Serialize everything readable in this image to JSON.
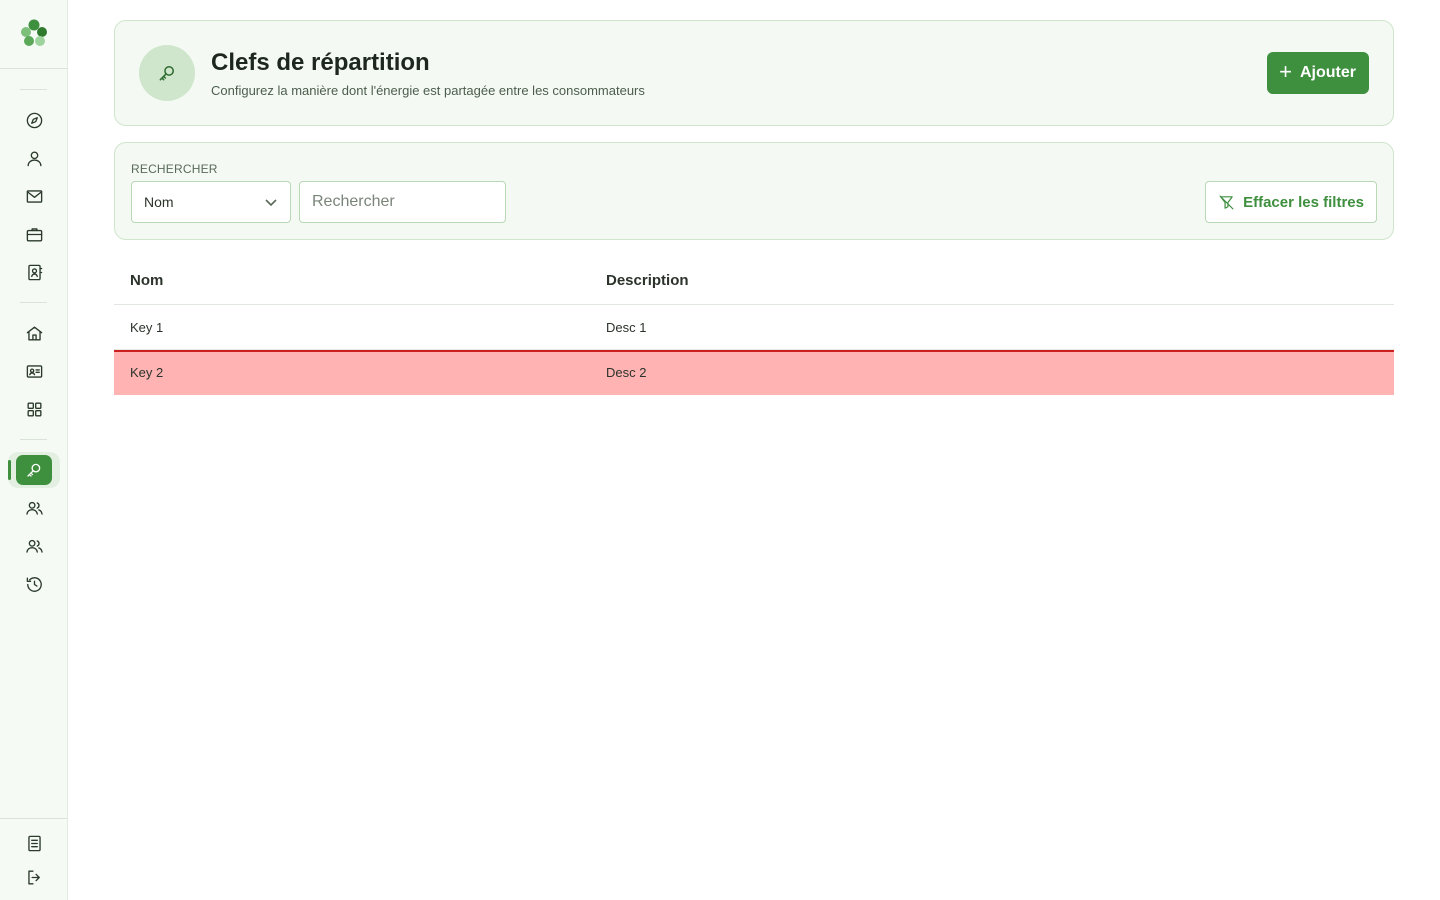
{
  "header": {
    "title": "Clefs de répartition",
    "subtitle": "Configurez la manière dont l'énergie est partagée entre les consommateurs",
    "add_label": "Ajouter"
  },
  "filters": {
    "label": "RECHERCHER",
    "field_selected": "Nom",
    "search_placeholder": "Rechercher",
    "search_value": "",
    "clear_label": "Effacer les filtres"
  },
  "table": {
    "columns": [
      "Nom",
      "Description"
    ],
    "rows": [
      {
        "name": "Key 1",
        "description": "Desc 1",
        "selected": false
      },
      {
        "name": "Key 2",
        "description": "Desc 2",
        "selected": true
      }
    ]
  },
  "sidebar": {
    "items": [
      {
        "icon": "compass-icon"
      },
      {
        "icon": "user-icon"
      },
      {
        "icon": "mail-icon"
      },
      {
        "icon": "briefcase-icon"
      },
      {
        "icon": "contact-book-icon"
      },
      {
        "icon": "home-icon"
      },
      {
        "icon": "id-card-icon"
      },
      {
        "icon": "grid-icon"
      },
      {
        "icon": "key-icon",
        "active": true
      },
      {
        "icon": "users-icon"
      },
      {
        "icon": "users-icon"
      },
      {
        "icon": "history-icon"
      }
    ],
    "bottom": [
      {
        "icon": "document-icon"
      },
      {
        "icon": "logout-icon"
      }
    ]
  },
  "colors": {
    "accent": "#3e8f3e",
    "card_bg": "#f4faf3",
    "selected_row": "#ffb3b3",
    "selected_border": "#cc1f1f"
  }
}
